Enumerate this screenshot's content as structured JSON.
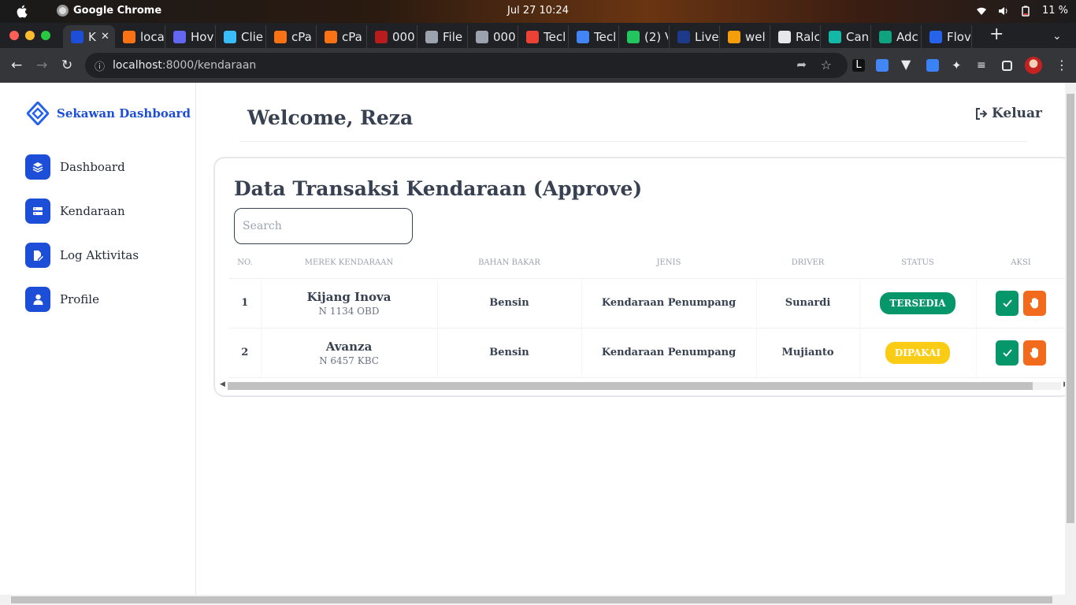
{
  "os": {
    "app_name": "Google Chrome",
    "clock": "Jul 27  10:24",
    "battery": "11 %"
  },
  "browser": {
    "tabs": [
      {
        "title": "K",
        "color": "#1d4ed8",
        "active": true
      },
      {
        "title": "loca",
        "color": "#f97316"
      },
      {
        "title": "Hov",
        "color": "#6366f1"
      },
      {
        "title": "Clie",
        "color": "#38bdf8"
      },
      {
        "title": "cPa",
        "color": "#f97316"
      },
      {
        "title": "cPa",
        "color": "#f97316"
      },
      {
        "title": "000",
        "color": "#b91c1c"
      },
      {
        "title": "File",
        "color": "#9ca3af"
      },
      {
        "title": "000",
        "color": "#9ca3af"
      },
      {
        "title": "Tecl",
        "color": "#ea4335"
      },
      {
        "title": "Tecl",
        "color": "#4285f4"
      },
      {
        "title": "(2) V",
        "color": "#22c55e"
      },
      {
        "title": "Live",
        "color": "#1e3a8a"
      },
      {
        "title": "wel",
        "color": "#f59e0b"
      },
      {
        "title": "Ralc",
        "color": "#e5e7eb"
      },
      {
        "title": "Can",
        "color": "#14b8a6"
      },
      {
        "title": "Adc",
        "color": "#10a37f"
      },
      {
        "title": "Flov",
        "color": "#2563eb"
      }
    ],
    "url_host": "localhost",
    "url_path": ":8000/kendaraan"
  },
  "sidebar": {
    "brand": "Sekawan Dashboard",
    "items": [
      {
        "label": "Dashboard",
        "icon": "layers-icon"
      },
      {
        "label": "Kendaraan",
        "icon": "server-icon"
      },
      {
        "label": "Log Aktivitas",
        "icon": "file-edit-icon"
      },
      {
        "label": "Profile",
        "icon": "user-icon"
      }
    ]
  },
  "header": {
    "welcome": "Welcome, Reza",
    "logout": "Keluar"
  },
  "card": {
    "title": "Data Transaksi Kendaraan (Approve)",
    "search_placeholder": "Search",
    "columns": [
      "NO.",
      "MEREK KENDARAAN",
      "BAHAN BAKAR",
      "JENIS",
      "DRIVER",
      "STATUS",
      "AKSI"
    ],
    "rows": [
      {
        "no": "1",
        "merek": "Kijang Inova",
        "plat": "N 1134 OBD",
        "bahan_bakar": "Bensin",
        "jenis": "Kendaraan Penumpang",
        "driver": "Sunardi",
        "status": "TERSEDIA",
        "status_color": "#059669"
      },
      {
        "no": "2",
        "merek": "Avanza",
        "plat": "N 6457 KBC",
        "bahan_bakar": "Bensin",
        "jenis": "Kendaraan Penumpang",
        "driver": "Mujianto",
        "status": "DIPAKAI",
        "status_color": "#facc15"
      }
    ],
    "approve_color": "#059669",
    "reject_color": "#f26a1b"
  }
}
